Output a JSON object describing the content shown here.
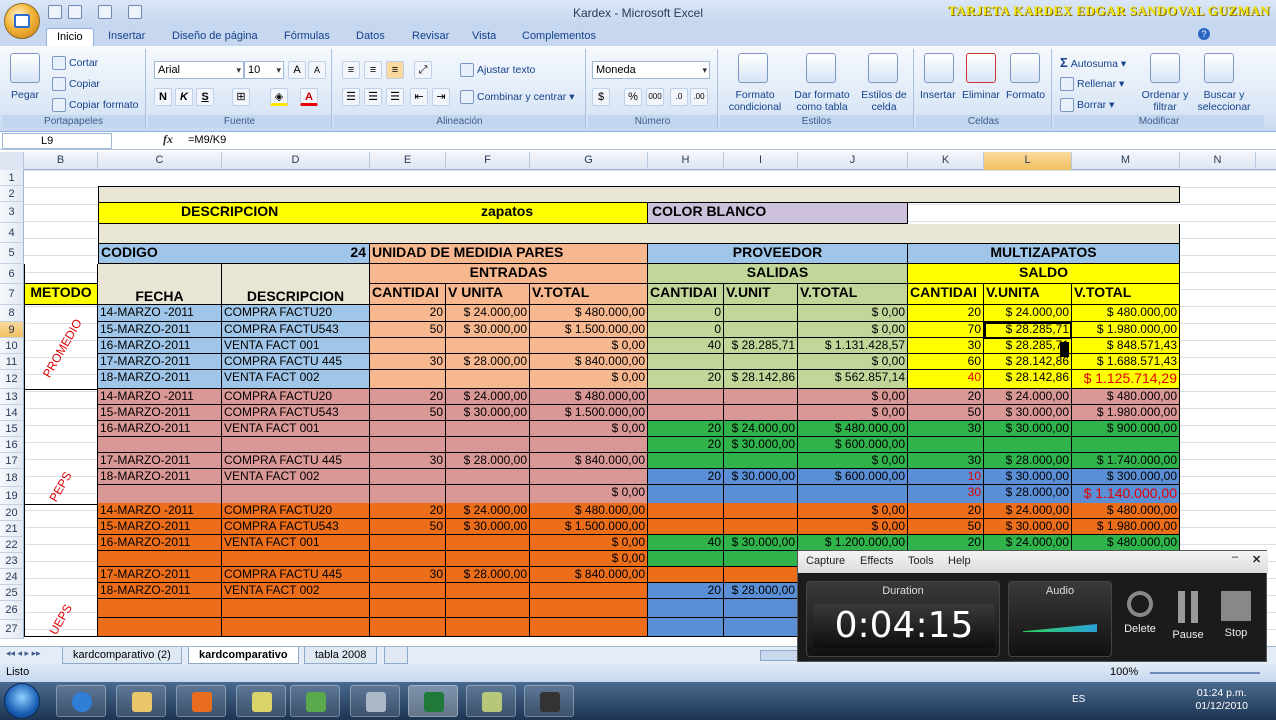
{
  "window": {
    "title": "Kardex - Microsoft Excel",
    "overlay_title": "TARJETA KARDEX  EDGAR SANDOVAL GUZMAN"
  },
  "tabs": [
    "Inicio",
    "Insertar",
    "Diseño de página",
    "Fórmulas",
    "Datos",
    "Revisar",
    "Vista",
    "Complementos"
  ],
  "ribbon": {
    "portapapeles": {
      "label": "Portapapeles",
      "pegar": "Pegar",
      "cortar": "Cortar",
      "copiar": "Copiar",
      "copiar_formato": "Copiar formato"
    },
    "fuente": {
      "label": "Fuente",
      "font": "Arial",
      "size": "10"
    },
    "alineacion": {
      "label": "Alineación",
      "ajustar": "Ajustar texto",
      "combinar": "Combinar y centrar"
    },
    "numero": {
      "label": "Número",
      "format": "Moneda"
    },
    "estilos": {
      "label": "Estilos",
      "formato_condicional": "Formato condicional",
      "dar_formato": "Dar formato como tabla",
      "estilos_celda": "Estilos de celda"
    },
    "celdas": {
      "label": "Celdas",
      "insertar": "Insertar",
      "eliminar": "Eliminar",
      "formato": "Formato"
    },
    "modificar": {
      "label": "Modificar",
      "autosuma": "Autosuma",
      "rellenar": "Rellenar",
      "borrar": "Borrar",
      "ordenar": "Ordenar y filtrar",
      "buscar": "Buscar y seleccionar"
    }
  },
  "formula_bar": {
    "name_box": "L9",
    "formula": "=M9/K9"
  },
  "columns": [
    "B",
    "C",
    "D",
    "E",
    "F",
    "G",
    "H",
    "I",
    "J",
    "K",
    "L",
    "M",
    "N"
  ],
  "rows": [
    "1",
    "2",
    "3",
    "4",
    "5",
    "6",
    "7",
    "8",
    "9",
    "10",
    "11",
    "12",
    "13",
    "14",
    "15",
    "16",
    "17",
    "18",
    "19",
    "20",
    "21",
    "22",
    "23",
    "24",
    "25",
    "26",
    "27"
  ],
  "sheet": {
    "descripcion_label": "DESCRIPCION",
    "descripcion_val": "zapatos",
    "color_label": "COLOR    BLANCO",
    "codigo_label": "CODIGO",
    "codigo_val": "24",
    "unidad": "UNIDAD DE MEDIDIA   PARES",
    "proveedor": "PROVEEDOR",
    "multizapatos": "MULTIZAPATOS",
    "entradas": "ENTRADAS",
    "salidas": "SALIDAS",
    "saldo": "SALDO",
    "h_metodo": "METODO",
    "h_fecha": "FECHA",
    "h_desc": "DESCRIPCION",
    "h_cant": "CANTIDAI",
    "h_vunita": "V UNITA",
    "h_vtotal": "V.TOTAL",
    "h_cant2": "CANTIDAI",
    "h_vunit2": "V.UNIT",
    "h_vtotal2": "V.TOTAL",
    "h_cant3": "CANTIDAI",
    "h_vunita3": "V.UNITA",
    "h_vtotal3": "V.TOTAL",
    "metodos": [
      "PROMEDIO",
      "PEPS",
      "UEPS"
    ],
    "prom": [
      [
        "14-MARZO -2011",
        "COMPRA FACTU20",
        "20",
        "$ 24.000,00",
        "$ 480.000,00",
        "0",
        "",
        "$ 0,00",
        "20",
        "$ 24.000,00",
        "$ 480.000,00"
      ],
      [
        "15-MARZO-2011",
        "COMPRA FACTU543",
        "50",
        "$ 30.000,00",
        "$ 1.500.000,00",
        "0",
        "",
        "$ 0,00",
        "70",
        "$ 28.285,71",
        "$ 1.980.000,00"
      ],
      [
        "16-MARZO-2011",
        "VENTA FACT 001",
        "",
        "",
        "$ 0,00",
        "40",
        "$ 28.285,71",
        "$ 1.131.428,57",
        "30",
        "$ 28.285,71",
        "$ 848.571,43"
      ],
      [
        "17-MARZO-2011",
        "COMPRA FACTU 445",
        "30",
        "$ 28.000,00",
        "$ 840.000,00",
        "",
        "",
        "$ 0,00",
        "60",
        "$ 28.142,86",
        "$ 1.688.571,43"
      ],
      [
        "18-MARZO-2011",
        "VENTA FACT 002",
        "",
        "",
        "$ 0,00",
        "20",
        "$ 28.142,86",
        "$ 562.857,14",
        "40",
        "$ 28.142,86",
        "$ 1.125.714,29"
      ]
    ],
    "peps": [
      [
        "14-MARZO -2011",
        "COMPRA FACTU20",
        "20",
        "$ 24.000,00",
        "$ 480.000,00",
        "",
        "",
        "$ 0,00",
        "20",
        "$ 24.000,00",
        "$ 480.000,00"
      ],
      [
        "15-MARZO-2011",
        "COMPRA FACTU543",
        "50",
        "$ 30.000,00",
        "$ 1.500.000,00",
        "",
        "",
        "$ 0,00",
        "50",
        "$ 30.000,00",
        "$ 1.980.000,00"
      ],
      [
        "16-MARZO-2011",
        "VENTA FACT 001",
        "",
        "",
        "$ 0,00",
        "20",
        "$ 24.000,00",
        "$ 480.000,00",
        "30",
        "$ 30.000,00",
        "$ 900.000,00"
      ],
      [
        "",
        "",
        "",
        "",
        "",
        "20",
        "$ 30.000,00",
        "$ 600.000,00",
        "",
        "",
        ""
      ],
      [
        "17-MARZO-2011",
        "COMPRA FACTU 445",
        "30",
        "$ 28.000,00",
        "$ 840.000,00",
        "",
        "",
        "$ 0,00",
        "30",
        "$ 28.000,00",
        "$ 1.740.000,00"
      ],
      [
        "18-MARZO-2011",
        "VENTA FACT 002",
        "",
        "",
        "",
        "20",
        "$ 30.000,00",
        "$ 600.000,00",
        "10",
        "$ 30.000,00",
        "$ 300.000,00"
      ],
      [
        "",
        "",
        "",
        "",
        "$ 0,00",
        "",
        "",
        "",
        "30",
        "$ 28.000,00",
        "$ 1.140.000,00"
      ]
    ],
    "ueps": [
      [
        "14-MARZO -2011",
        "COMPRA FACTU20",
        "20",
        "$ 24.000,00",
        "$ 480.000,00",
        "",
        "",
        "$ 0,00",
        "20",
        "$ 24.000,00",
        "$ 480.000,00"
      ],
      [
        "15-MARZO-2011",
        "COMPRA FACTU543",
        "50",
        "$ 30.000,00",
        "$ 1.500.000,00",
        "",
        "",
        "$ 0,00",
        "50",
        "$ 30.000,00",
        "$ 1.980.000,00"
      ],
      [
        "16-MARZO-2011",
        "VENTA FACT 001",
        "",
        "",
        "$ 0,00",
        "40",
        "$ 30.000,00",
        "$ 1.200.000,00",
        "20",
        "$ 24.000,00",
        "$ 480.000,00"
      ],
      [
        "",
        "",
        "",
        "",
        "$ 0,00",
        "",
        "",
        "",
        "",
        "",
        ""
      ],
      [
        "17-MARZO-2011",
        "COMPRA FACTU 445",
        "30",
        "$ 28.000,00",
        "$ 840.000,00",
        "",
        "",
        "",
        "",
        "",
        ""
      ],
      [
        "18-MARZO-2011",
        "VENTA FACT 002",
        "",
        "",
        "",
        "20",
        "$ 28.000,00",
        "",
        "",
        "",
        ""
      ],
      [
        "",
        "",
        "",
        "",
        "",
        "",
        "",
        "",
        "",
        "",
        ""
      ],
      [
        "",
        "",
        "",
        "",
        "",
        "",
        "",
        "",
        "",
        "",
        ""
      ]
    ]
  },
  "sheet_tabs": [
    "kardcomparativo (2)",
    "kardcomparativo",
    "tabla 2008"
  ],
  "status": {
    "ready": "Listo",
    "zoom": "100%"
  },
  "recorder": {
    "menu": [
      "Capture",
      "Effects",
      "Tools",
      "Help"
    ],
    "duration_label": "Duration",
    "duration": "0:04:15",
    "audio_label": "Audio",
    "delete": "Delete",
    "pause": "Pause",
    "stop": "Stop"
  },
  "taskbar": {
    "lang": "ES",
    "time": "01:24 p.m.",
    "date": "01/12/2010"
  },
  "colors": {
    "accent": "#15428b",
    "saldo_yellow": "#ffff00",
    "peps_green": "#2fb34a",
    "ueps_orange": "#ec6e1a"
  }
}
